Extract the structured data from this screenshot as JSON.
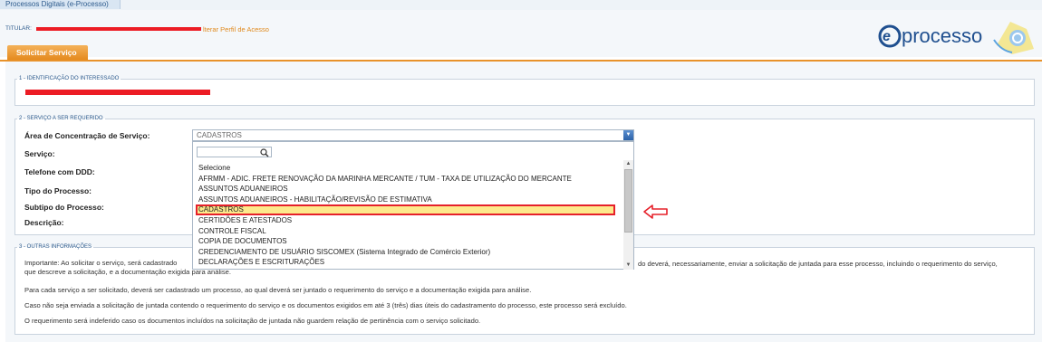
{
  "app": {
    "tab_title": "Processos Digitais (e-Processo)"
  },
  "header": {
    "titular_label": "TITULAR:",
    "alterar_perfil": "lterar Perfil de Acesso",
    "logo_text": "processo"
  },
  "tab": {
    "label": "Solicitar Serviço"
  },
  "section1": {
    "legend": "1 - IDENTIFICAÇÃO DO INTERESSADO"
  },
  "section2": {
    "legend": "2 - SERVIÇO A SER REQUERIDO",
    "labels": {
      "area": "Área de Concentração de Serviço:",
      "servico": "Serviço:",
      "telefone": "Telefone com DDD:",
      "tipo": "Tipo do Processo:",
      "subtipo": "Subtipo do Processo:",
      "descricao": "Descrição:"
    },
    "area_select": {
      "value": "CADASTROS",
      "options": [
        "Selecione",
        "AFRMM - ADIC. FRETE RENOVAÇÃO DA MARINHA MERCANTE / TUM - TAXA DE UTILIZAÇÃO DO MERCANTE",
        "ASSUNTOS ADUANEIROS",
        "ASSUNTOS ADUANEIROS - HABILITAÇÃO/REVISÃO DE ESTIMATIVA",
        "CADASTROS",
        "CERTIDÕES E ATESTADOS",
        "CONTROLE FISCAL",
        "COPIA DE DOCUMENTOS",
        "CREDENCIAMENTO DE USUÁRIO SISCOMEX (Sistema Integrado de Comércio Exterior)",
        "DECLARAÇÕES E ESCRITURAÇÕES"
      ],
      "selected_index": 4
    }
  },
  "section3": {
    "legend": "3 - OUTRAS INFORMAÇÕES",
    "para1_left": "Importante: Ao solicitar o serviço, será cadastrado",
    "para1_right": "do deverá, necessariamente, enviar a solicitação de juntada para esse processo, incluindo o requerimento do serviço,",
    "para1_line2": "que descreve a solicitação, e a documentação exigida para análise.",
    "para2": "Para cada serviço a ser solicitado, deverá ser cadastrado um processo, ao qual deverá ser juntado o requerimento do serviço e a documentação exigida para análise.",
    "para3": "Caso não seja enviada a solicitação de juntada contendo o requerimento do serviço e os documentos exigidos em até 3 (três) dias úteis do cadastramento do processo, este processo será excluído.",
    "para4": "O requerimento será indeferido caso os documentos incluídos na solicitação de juntada não guardem relação de pertinência com o serviço solicitado."
  },
  "colors": {
    "accent": "#e58a1f",
    "link": "#2c5a8c",
    "highlight": "#fde98c",
    "annotation": "#e6202a"
  }
}
